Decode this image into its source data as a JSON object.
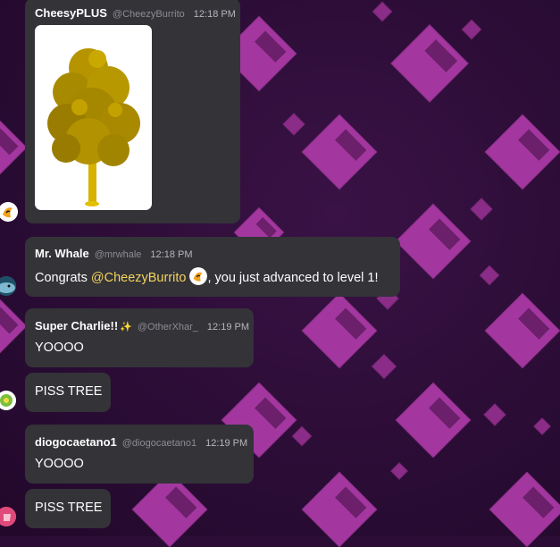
{
  "messages": [
    {
      "name": "CheesyPLUS",
      "handle": "@CheezyBurrito",
      "time": "12:18 PM",
      "image_alt": "golden tree"
    },
    {
      "name": "Mr. Whale",
      "handle": "@mrwhale",
      "time": "12:18 PM",
      "text_prefix": "Congrats ",
      "mention": "@CheezyBurrito",
      "text_suffix": ", you just advanced to level 1!"
    },
    {
      "name": "Super Charlie!!",
      "name_emoji": "✨",
      "handle": "@OtherXhar_",
      "time": "12:19 PM",
      "text": "YOOOO",
      "followup": "PISS TREE"
    },
    {
      "name": "diogocaetano1",
      "handle": "@diogocaetano1",
      "time": "12:19 PM",
      "text": "YOOOO",
      "followup": "PISS TREE"
    }
  ],
  "colors": {
    "bubble": "#333338",
    "mention": "#f4d35e",
    "background": "#2b0d36",
    "diamond": "#a3379f"
  }
}
